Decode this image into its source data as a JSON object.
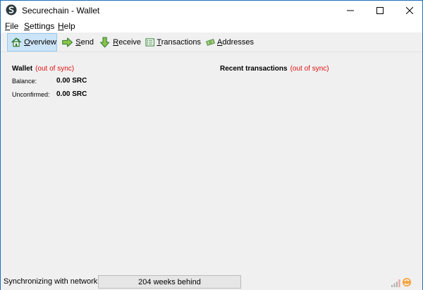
{
  "window": {
    "title": "Securechain - Wallet"
  },
  "menu": [
    {
      "label": "File",
      "underline": "F",
      "rest": "ile"
    },
    {
      "label": "Settings",
      "underline": "S",
      "rest": "ettings"
    },
    {
      "label": "Help",
      "underline": "H",
      "rest": "elp"
    }
  ],
  "toolbar": {
    "overview": {
      "underline": "O",
      "rest": "verview",
      "icon": "home-icon"
    },
    "send": {
      "underline": "S",
      "rest": "end",
      "icon": "arrow-right-icon"
    },
    "receive": {
      "underline": "R",
      "rest": "eceive",
      "icon": "arrow-down-icon"
    },
    "transactions": {
      "underline": "T",
      "rest": "ransactions",
      "icon": "list-icon"
    },
    "addresses": {
      "underline": "A",
      "rest": "ddresses",
      "icon": "money-icon"
    }
  },
  "wallet": {
    "title": "Wallet",
    "sync_status": "(out of sync)",
    "balance_label": "Balance:",
    "balance_value": "0.00 SRC",
    "unconfirmed_label": "Unconfirmed:",
    "unconfirmed_value": "0.00 SRC"
  },
  "recent": {
    "title": "Recent transactions",
    "sync_status": "(out of sync)"
  },
  "status": {
    "text": "Synchronizing with network...",
    "progress_text": "204 weeks behind",
    "progress_fraction": 0.0
  },
  "colors": {
    "warning": "#e01010",
    "active_tab_bg": "#cce4f7",
    "progress_green": "#06b025"
  }
}
